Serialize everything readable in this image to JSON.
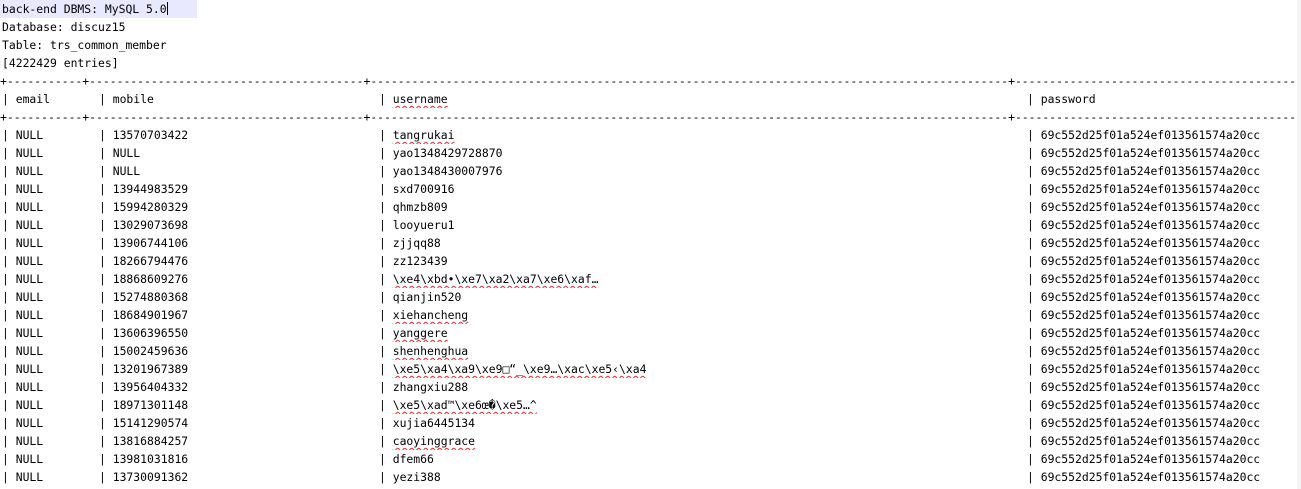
{
  "header_lines": [
    "back-end DBMS: MySQL 5.0",
    "Database: discuz15",
    "Table: trs_common_member",
    "[4222429 entries]"
  ],
  "divider": "+-----------+----------------------------------------+---------------------------------------------------------------------------------------------+---------------------------------------------------",
  "columns": {
    "email": "email",
    "mobile": "mobile",
    "username": "username",
    "password": "password"
  },
  "rows": [
    {
      "email": "NULL",
      "mobile": "13570703422",
      "username": "tangrukai",
      "password": "69c552d25f01a524ef013561574a20cc",
      "flagged": true
    },
    {
      "email": "NULL",
      "mobile": "NULL",
      "username": "yao1348429728870",
      "password": "69c552d25f01a524ef013561574a20cc",
      "flagged": false
    },
    {
      "email": "NULL",
      "mobile": "NULL",
      "username": "yao1348430007976",
      "password": "69c552d25f01a524ef013561574a20cc",
      "flagged": false
    },
    {
      "email": "NULL",
      "mobile": "13944983529",
      "username": "sxd700916",
      "password": "69c552d25f01a524ef013561574a20cc",
      "flagged": false
    },
    {
      "email": "NULL",
      "mobile": "15994280329",
      "username": "qhmzb809",
      "password": "69c552d25f01a524ef013561574a20cc",
      "flagged": false
    },
    {
      "email": "NULL",
      "mobile": "13029073698",
      "username": "looyueru1",
      "password": "69c552d25f01a524ef013561574a20cc",
      "flagged": false
    },
    {
      "email": "NULL",
      "mobile": "13906744106",
      "username": "zjjqq88",
      "password": "69c552d25f01a524ef013561574a20cc",
      "flagged": false
    },
    {
      "email": "NULL",
      "mobile": "18266794476",
      "username": "zz123439",
      "password": "69c552d25f01a524ef013561574a20cc",
      "flagged": false
    },
    {
      "email": "NULL",
      "mobile": "18868609276",
      "username": "\\xe4\\xbd•\\xe7\\xa2\\xa7\\xe6\\xaf…",
      "password": "69c552d25f01a524ef013561574a20cc",
      "flagged": true
    },
    {
      "email": "NULL",
      "mobile": "15274880368",
      "username": "qianjin520",
      "password": "69c552d25f01a524ef013561574a20cc",
      "flagged": false
    },
    {
      "email": "NULL",
      "mobile": "18684901967",
      "username": "xiehancheng",
      "password": "69c552d25f01a524ef013561574a20cc",
      "flagged": true
    },
    {
      "email": "NULL",
      "mobile": "13606396550",
      "username": "yanggere",
      "password": "69c552d25f01a524ef013561574a20cc",
      "flagged": true
    },
    {
      "email": "NULL",
      "mobile": "15002459636",
      "username": "shenhenghua",
      "password": "69c552d25f01a524ef013561574a20cc",
      "flagged": true
    },
    {
      "email": "NULL",
      "mobile": "13201967389",
      "username": "\\xe5\\xa4\\xa9\\xe9□“_\\xe9…\\xac\\xe5‹\\xa4",
      "password": "69c552d25f01a524ef013561574a20cc",
      "flagged": true
    },
    {
      "email": "NULL",
      "mobile": "13956404332",
      "username": "zhangxiu288",
      "password": "69c552d25f01a524ef013561574a20cc",
      "flagged": false
    },
    {
      "email": "NULL",
      "mobile": "18971301148",
      "username": "\\xe5\\xad™\\xe6œ�\\xe5…^",
      "password": "69c552d25f01a524ef013561574a20cc",
      "flagged": true
    },
    {
      "email": "NULL",
      "mobile": "15141290574",
      "username": "xujia6445134",
      "password": "69c552d25f01a524ef013561574a20cc",
      "flagged": false
    },
    {
      "email": "NULL",
      "mobile": "13816884257",
      "username": "caoyinggrace",
      "password": "69c552d25f01a524ef013561574a20cc",
      "flagged": true
    },
    {
      "email": "NULL",
      "mobile": "13981031816",
      "username": "dfem66",
      "password": "69c552d25f01a524ef013561574a20cc",
      "flagged": false
    },
    {
      "email": "NULL",
      "mobile": "13730091362",
      "username": "yezi388",
      "password": "69c552d25f01a524ef013561574a20cc",
      "flagged": false
    }
  ]
}
